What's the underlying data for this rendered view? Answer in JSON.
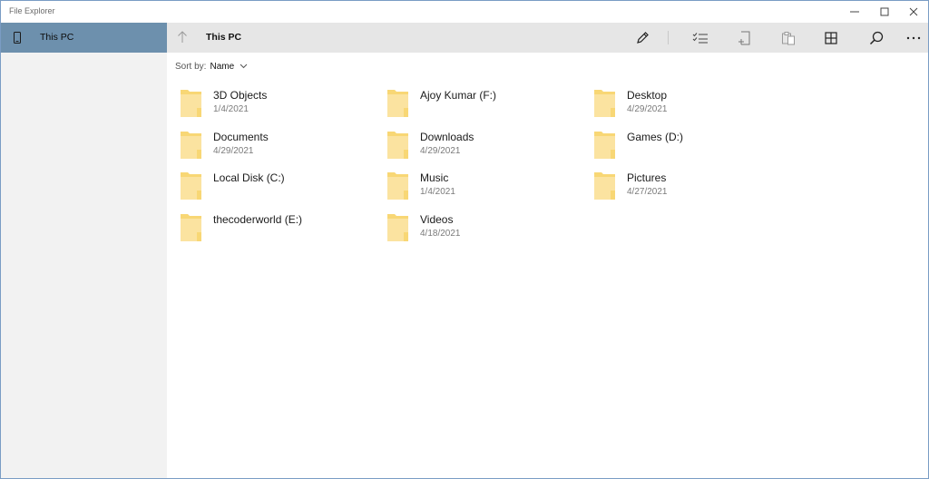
{
  "window": {
    "title": "File Explorer"
  },
  "sidebar": {
    "items": [
      {
        "label": "This PC",
        "icon": "device-icon",
        "selected": true
      }
    ]
  },
  "toolbar": {
    "path_title": "This PC",
    "buttons": [
      "rename-icon",
      "select-icon",
      "new-icon",
      "paste-icon",
      "view-icon",
      "search-icon",
      "more-icon"
    ]
  },
  "sort": {
    "label": "Sort by:",
    "value": "Name"
  },
  "items": [
    {
      "name": "3D Objects",
      "date": "1/4/2021"
    },
    {
      "name": "Ajoy Kumar (F:)",
      "date": ""
    },
    {
      "name": "Desktop",
      "date": "4/29/2021"
    },
    {
      "name": "Documents",
      "date": "4/29/2021"
    },
    {
      "name": "Downloads",
      "date": "4/29/2021"
    },
    {
      "name": "Games (D:)",
      "date": ""
    },
    {
      "name": "Local Disk (C:)",
      "date": ""
    },
    {
      "name": "Music",
      "date": "1/4/2021"
    },
    {
      "name": "Pictures",
      "date": "4/27/2021"
    },
    {
      "name": "thecoderworld (E:)",
      "date": ""
    },
    {
      "name": "Videos",
      "date": "4/18/2021"
    }
  ],
  "colors": {
    "sidebar_selected": "#6d90ad",
    "toolbar_bg": "#e6e6e6",
    "sidebar_bg": "#f2f2f2",
    "folder_fill": "#f8d775",
    "folder_front": "#fbe3a0"
  }
}
